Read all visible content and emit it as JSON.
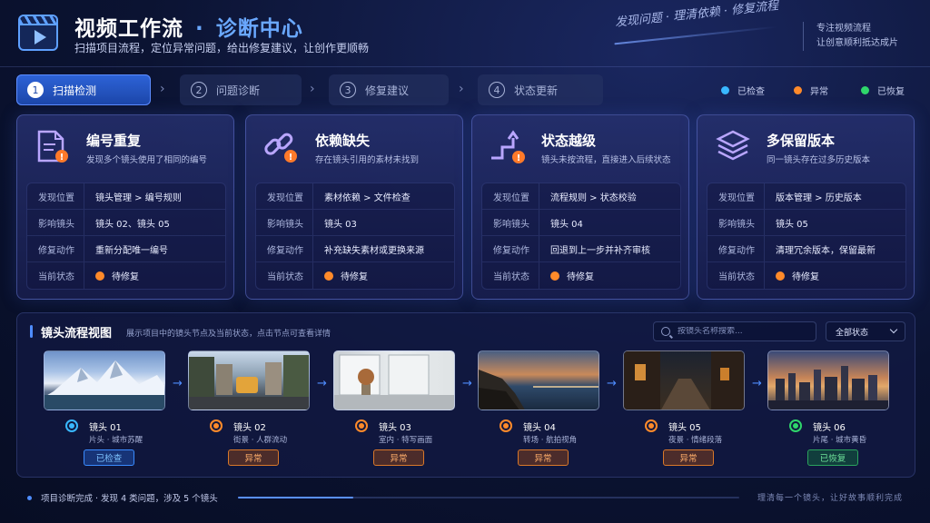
{
  "header": {
    "title_main": "视频工作流",
    "title_sep": "·",
    "title_accent": "诊断中心",
    "subtitle": "扫描项目流程，定位异常问题，给出修复建议，让创作更顺畅",
    "slogan": "发现问题 · 理清依赖 · 修复流程",
    "tagline_line1": "专注视频流程",
    "tagline_line2": "让创意顺利抵达成片"
  },
  "steps": [
    {
      "num": "1",
      "label": "扫描检测",
      "active": true
    },
    {
      "num": "2",
      "label": "问题诊断",
      "active": false
    },
    {
      "num": "3",
      "label": "修复建议",
      "active": false
    },
    {
      "num": "4",
      "label": "状态更新",
      "active": false
    }
  ],
  "legend": [
    {
      "label": "已检查",
      "color": "#39b8ff"
    },
    {
      "label": "异常",
      "color": "#ff8a2a"
    },
    {
      "label": "已恢复",
      "color": "#2fd66b"
    }
  ],
  "cards": [
    {
      "icon": "document-warning-icon",
      "title": "编号重复",
      "desc": "发现多个镜头使用了相同的编号",
      "rows": [
        {
          "key": "发现位置",
          "value": "镜头管理 > 编号规则"
        },
        {
          "key": "影响镜头",
          "value": "镜头 02、镜头 05"
        },
        {
          "key": "修复动作",
          "value": "重新分配唯一编号"
        },
        {
          "key": "当前状态",
          "value": "待修复"
        }
      ]
    },
    {
      "icon": "broken-link-icon",
      "title": "依赖缺失",
      "desc": "存在镜头引用的素材未找到",
      "rows": [
        {
          "key": "发现位置",
          "value": "素材依赖 > 文件检查"
        },
        {
          "key": "影响镜头",
          "value": "镜头 03"
        },
        {
          "key": "修复动作",
          "value": "补充缺失素材或更换来源"
        },
        {
          "key": "当前状态",
          "value": "待修复"
        }
      ]
    },
    {
      "icon": "step-jump-icon",
      "title": "状态越级",
      "desc": "镜头未按流程，直接进入后续状态",
      "rows": [
        {
          "key": "发现位置",
          "value": "流程规则 > 状态校验"
        },
        {
          "key": "影响镜头",
          "value": "镜头 04"
        },
        {
          "key": "修复动作",
          "value": "回退到上一步并补齐审核"
        },
        {
          "key": "当前状态",
          "value": "待修复"
        }
      ]
    },
    {
      "icon": "layers-icon",
      "title": "多保留版本",
      "desc": "同一镜头存在过多历史版本",
      "rows": [
        {
          "key": "发现位置",
          "value": "版本管理 > 历史版本"
        },
        {
          "key": "影响镜头",
          "value": "镜头 05"
        },
        {
          "key": "修复动作",
          "value": "清理冗余版本，保留最新"
        },
        {
          "key": "当前状态",
          "value": "待修复"
        }
      ]
    }
  ],
  "flow": {
    "title": "镜头流程视图",
    "desc": "展示项目中的镜头节点及当前状态，点击节点可查看详情",
    "search_placeholder": "按镜头名称搜索...",
    "filter_value": "全部状态",
    "shots": [
      {
        "name": "镜头 01",
        "sub": "片头 · 城市苏醒",
        "status": "已检查",
        "kind": "checked",
        "color": "#39b8ff"
      },
      {
        "name": "镜头 02",
        "sub": "街景 · 人群流动",
        "status": "异常",
        "kind": "abnormal",
        "color": "#ff8a2a"
      },
      {
        "name": "镜头 03",
        "sub": "室内 · 特写画面",
        "status": "异常",
        "kind": "abnormal",
        "color": "#ff8a2a"
      },
      {
        "name": "镜头 04",
        "sub": "转场 · 航拍视角",
        "status": "异常",
        "kind": "abnormal",
        "color": "#ff8a2a"
      },
      {
        "name": "镜头 05",
        "sub": "夜景 · 情绪段落",
        "status": "异常",
        "kind": "abnormal",
        "color": "#ff8a2a"
      },
      {
        "name": "镜头 06",
        "sub": "片尾 · 城市黄昏",
        "status": "已恢复",
        "kind": "recovered",
        "color": "#2fd66b"
      }
    ]
  },
  "footer": {
    "status": "项目诊断完成 · 发现 4 类问题，涉及 5 个镜头",
    "progress": 0.23,
    "right_text": "理清每一个镜头，让好故事顺利完成"
  }
}
